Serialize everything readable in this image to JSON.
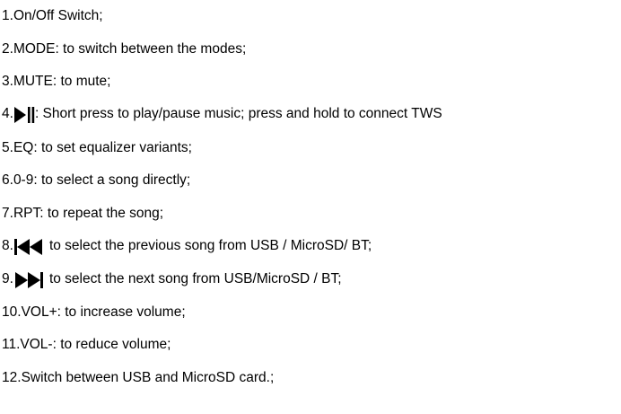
{
  "manual": {
    "items": [
      {
        "num": "1. ",
        "text": "On/Off Switch;"
      },
      {
        "num": "2. ",
        "text": "MODE: to switch between the modes;"
      },
      {
        "num": "3. ",
        "text": "MUTE: to mute;"
      },
      {
        "num": "4. ",
        "icon": "play-pause-icon",
        "text": ": Short press to play/pause music; press and hold to connect TWS"
      },
      {
        "num": "5. ",
        "text": "EQ: to set equalizer variants;"
      },
      {
        "num": "6. ",
        "text": "0-9: to select a song directly;"
      },
      {
        "num": "7. ",
        "text": "RPT: to repeat the song;"
      },
      {
        "num": "8.",
        "icon": "previous-track-icon",
        "text": "to select the previous song from USB / MicroSD/ BT;"
      },
      {
        "num": "9.",
        "icon": "next-track-icon",
        "text": "to select the next song from USB/MicroSD / BT;"
      },
      {
        "num": "10. ",
        "text": "VOL+: to increase volume;"
      },
      {
        "num": "11. ",
        "text": "VOL-: to reduce volume;"
      },
      {
        "num": "12. ",
        "text": "Switch between USB and MicroSD card.;"
      }
    ]
  }
}
